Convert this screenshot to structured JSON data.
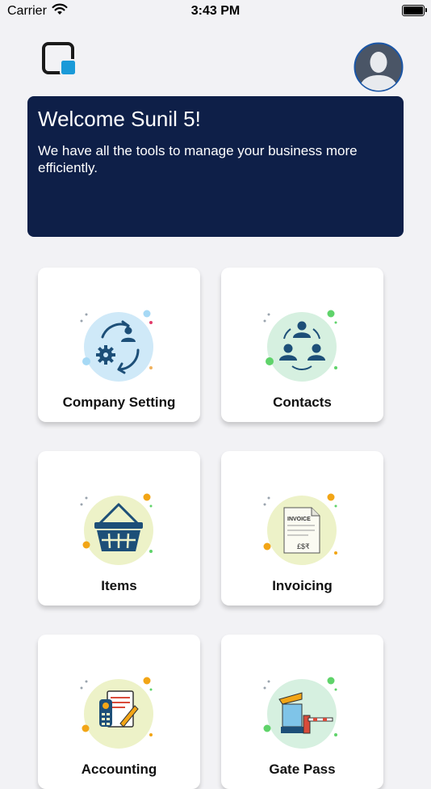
{
  "status_bar": {
    "carrier": "Carrier",
    "time": "3:43 PM"
  },
  "header": {
    "logo_icon": "app-logo-icon",
    "avatar_icon": "user-avatar-icon"
  },
  "welcome": {
    "title": "Welcome Sunil 5!",
    "subtitle": "We have all the tools to manage your business more efficiently."
  },
  "tiles": [
    {
      "label": "Company Setting",
      "icon": "company-setting-icon"
    },
    {
      "label": "Contacts",
      "icon": "contacts-icon"
    },
    {
      "label": "Items",
      "icon": "basket-icon"
    },
    {
      "label": "Invoicing",
      "icon": "invoice-icon"
    },
    {
      "label": "Accounting",
      "icon": "accounting-icon"
    },
    {
      "label": "Gate Pass",
      "icon": "gate-pass-icon"
    }
  ],
  "invoice_icon_text": {
    "header": "INVOICE",
    "currencies": "£$₹"
  },
  "colors": {
    "banner": "#0e1f48",
    "accent_blue": "#1a9ad8",
    "icon_dark_blue": "#1d4f78",
    "bubble_blue": "#cfe9f8",
    "bubble_green": "#d6f0e0",
    "bubble_yellow": "#edf2c8",
    "dot_orange": "#f2a516",
    "dot_green": "#5fd36a"
  }
}
